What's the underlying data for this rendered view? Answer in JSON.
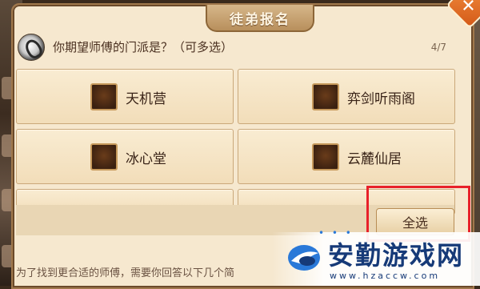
{
  "dialog": {
    "title": "徒弟报名",
    "question": "你期望师傅的门派是？（可多选）",
    "progress": "4/7",
    "select_all_label": "全选",
    "hint": "为了找到更合适的师傅，需要你回答以下几个简"
  },
  "options": [
    {
      "label": "天机营",
      "checked": false
    },
    {
      "label": "弈剑听雨阁",
      "checked": false
    },
    {
      "label": "冰心堂",
      "checked": false
    },
    {
      "label": "云麓仙居",
      "checked": false
    },
    {
      "label": "",
      "checked": false
    },
    {
      "label": "",
      "checked": false
    }
  ],
  "watermark": {
    "title": "安勤游戏网",
    "url": "www.hzaccw.com"
  },
  "colors": {
    "panel": "#f6e8cf",
    "accent": "#d45a18",
    "highlight": "#e8212a",
    "watermark": "#163a78"
  },
  "icons": [
    "close-icon",
    "question-icon",
    "checkbox-icon",
    "site-logo-icon"
  ]
}
